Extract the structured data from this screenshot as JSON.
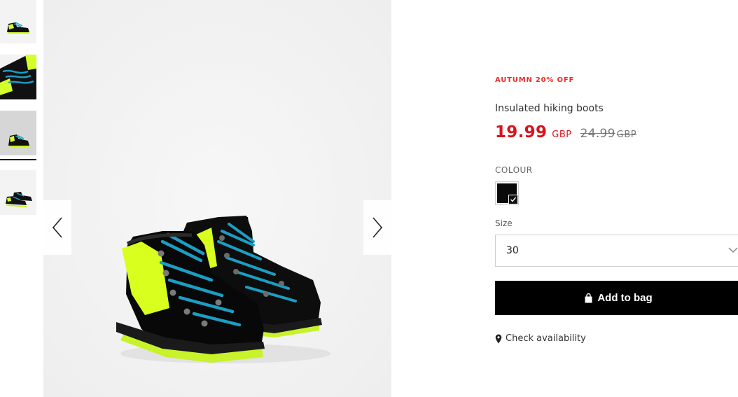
{
  "gallery": {
    "thumbnails": [
      {
        "alt": "boots-side-view"
      },
      {
        "alt": "boots-laces-closeup"
      },
      {
        "alt": "boots-grey-background"
      },
      {
        "alt": "boots-pair-angle"
      }
    ],
    "selected_thumbnail": 3,
    "prev_icon": "chevron-left-icon",
    "next_icon": "chevron-right-icon"
  },
  "product": {
    "promo": "AUTUMN 20% OFF",
    "title": "Insulated hiking boots",
    "price": "19.99",
    "price_currency": "GBP",
    "old_price": "24.99",
    "old_price_currency": "GBP"
  },
  "colour": {
    "label": "COLOUR",
    "selected": "black",
    "swatch_color": "#0a0a0a"
  },
  "size": {
    "label": "Size",
    "selected": "30"
  },
  "actions": {
    "add_to_bag": "Add to bag",
    "add_icon": "shopping-bag-icon",
    "check_availability": "Check availability",
    "check_icon": "map-pin-icon"
  },
  "colors": {
    "promo": "#e2332a",
    "price": "#d9141c",
    "button_bg": "#000000"
  }
}
